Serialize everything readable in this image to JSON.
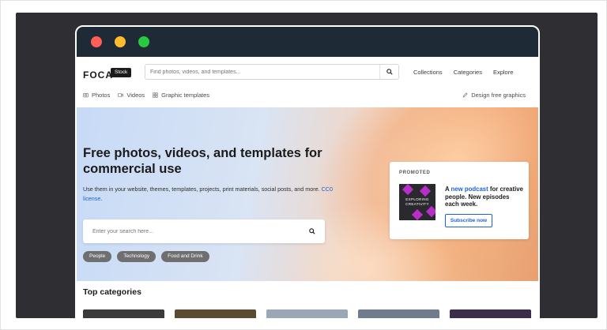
{
  "window": {
    "controls": [
      "close",
      "minimize",
      "maximize"
    ]
  },
  "nav": {
    "logo": "FOCA",
    "logo_badge": "Stock",
    "search_placeholder": "Find photos, videos, and templates...",
    "links": [
      "Collections",
      "Categories",
      "Explore"
    ],
    "subnav": [
      {
        "label": "Photos",
        "icon": "camera-icon"
      },
      {
        "label": "Videos",
        "icon": "video-icon"
      },
      {
        "label": "Graphic templates",
        "icon": "grid-icon"
      }
    ],
    "design_link": "Design free graphics"
  },
  "hero": {
    "title": "Free photos, videos, and templates for commercial use",
    "desc_main": "Use them in your website, themes, templates, projects, print materials, social posts, and more.",
    "desc_link": "CC0 license",
    "desc_end": ".",
    "search_placeholder": "Enter your search here...",
    "tags": [
      "People",
      "Technology",
      "Food and Drink"
    ]
  },
  "promo": {
    "label": "PROMOTED",
    "image_caption": "EXPLORING CREATIVITY",
    "text_pre": "A ",
    "text_link": "new podcast",
    "text_post": " for creative people. New episodes each week.",
    "button": "Subscribe now"
  },
  "categories": {
    "title": "Top categories",
    "thumb_colors": [
      "#3b3b3b",
      "#5b4a32",
      "#9aa7b6",
      "#6e7c8e",
      "#3a2e4a"
    ]
  },
  "colors": {
    "accent": "#1d63d6",
    "titlebar": "#1f2a37",
    "tag": "#6f6f6f"
  }
}
